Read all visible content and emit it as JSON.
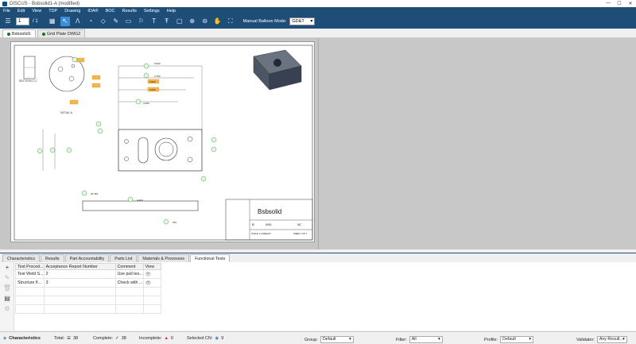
{
  "window": {
    "title": "DISCUS - Bsbsolid1-A (modified)",
    "controls": [
      "—",
      "☐",
      "✕"
    ]
  },
  "menu": [
    "File",
    "Edit",
    "View",
    "TDP",
    "Drawing",
    "IDA®",
    "BOC",
    "Results",
    "Settings",
    "Help"
  ],
  "toolbar": {
    "page_value": "1",
    "page_total": "/ 1",
    "balloon_mode_label": "Manual Balloon Mode:",
    "balloon_mode_value": "GD&T",
    "tools": [
      "grid-view",
      "select-cursor",
      "balloon-tool",
      "lasso-tool",
      "pencil-tool",
      "rectangle-tool",
      "flag-tool",
      "text-tool",
      "text-box-tool",
      "shape-tool",
      "zoom-in",
      "zoom-out",
      "pan-hand",
      "fit-tool"
    ]
  },
  "doc_tabs": [
    {
      "label": "Bsbsolid1",
      "active": true
    },
    {
      "label": "Grid Plate DWG2",
      "active": false
    }
  ],
  "drawing": {
    "part_title": "Bsbsolid",
    "section_label": "SECTION C-C",
    "detail_label": "DETAIL A",
    "dwg_no": "0001",
    "rev": "NC",
    "size": "B",
    "sheet": "SHEET 1 OF 1",
    "scale": "SCALE: 1:2  WEIGHT:",
    "dims": [
      ".500",
      "1.000",
      "3.750",
      "8.000",
      "4.400",
      "3.750",
      ".250",
      "2.000",
      "1.000",
      ".500",
      "2.000",
      "3.000",
      "4.000",
      "9.000",
      "33 3PL",
      ".750",
      "1.000"
    ],
    "orange_dims": [
      "1.000",
      "1.000",
      ".500",
      "2.000",
      "5.000",
      "1.000"
    ]
  },
  "bottom_tabs": [
    "Characteristics",
    "Results",
    "Part Accountability",
    "Parts List",
    "Materials & Processes",
    "Functional Tests"
  ],
  "active_bottom_tab": "Functional Tests",
  "grid": {
    "columns": [
      "Test Proced...",
      "Acceptance Report Number",
      "Comment",
      "View"
    ],
    "rows": [
      {
        "proc": "Test Weld S...",
        "num": "2",
        "comment": "Use pull tes...",
        "view": "👁"
      },
      {
        "proc": "Structure fl...",
        "num": "3",
        "comment": "Check with ...",
        "view": "👁"
      }
    ]
  },
  "status": {
    "section": "Characteristics",
    "total_label": "Total:",
    "total": "38",
    "complete_label": "Complete:",
    "complete": "38",
    "incomplete_label": "Incomplete:",
    "incomplete": "0",
    "selected_label": "Selected CN:",
    "selected": "9",
    "group_label": "Group:",
    "group_value": "Default",
    "filter_label": "Filter:",
    "filter_value": "All",
    "profile_label": "Profile:",
    "profile_value": "Default",
    "validator_label": "Validator:",
    "validator_value": "Any Result..."
  }
}
